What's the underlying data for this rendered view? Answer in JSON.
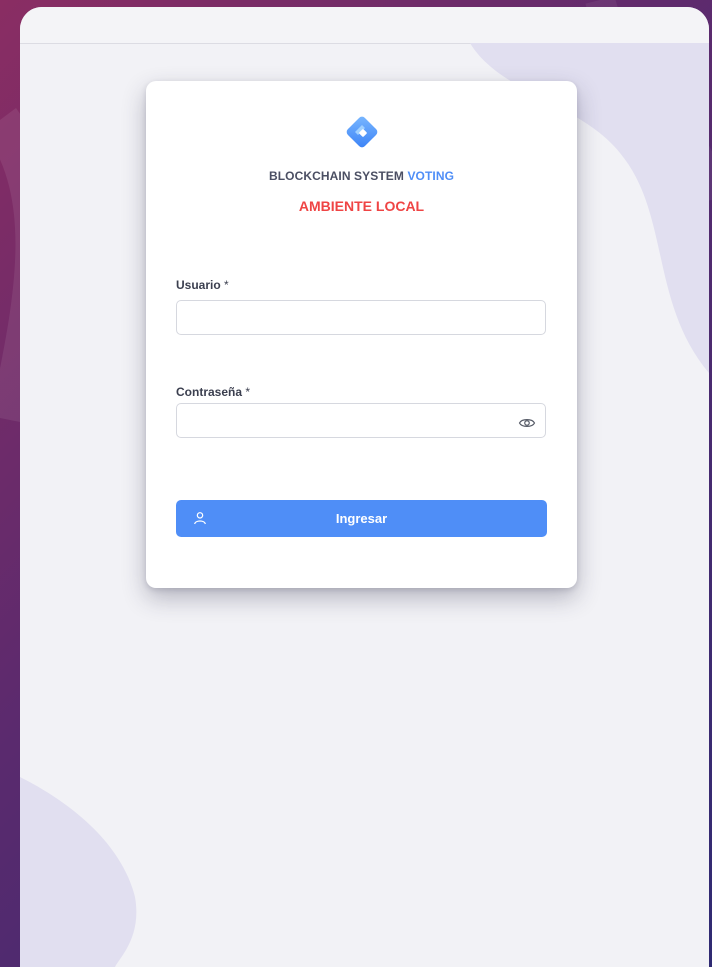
{
  "login": {
    "brand_main": "BLOCKCHAIN SYSTEM",
    "brand_accent": "VOTING",
    "environment": "AMBIENTE LOCAL",
    "username_label": "Usuario",
    "password_label": "Contraseña",
    "required_mark": "*",
    "username_value": "",
    "password_value": "",
    "submit_label": "Ingresar"
  },
  "icons": {
    "logo": "diamond-logo-icon",
    "password_toggle": "eye-icon",
    "submit": "user-icon"
  },
  "colors": {
    "accent": "#4f8ef7",
    "environment": "#ef4444",
    "text": "#4b4f63"
  }
}
